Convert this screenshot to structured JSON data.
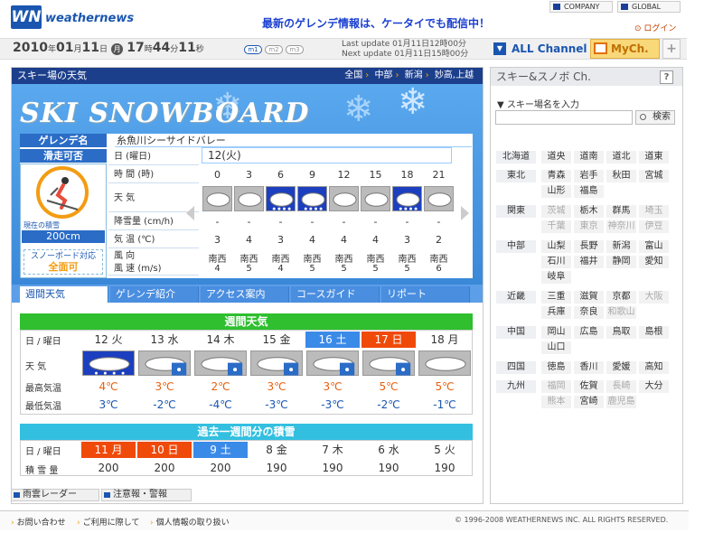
{
  "header": {
    "logo_mark": "WN",
    "logo_text": "weathernews",
    "promo": "最新のゲレンデ情報は、ケータイでも配信中！",
    "company": "COMPANY",
    "global": "GLOBAL",
    "login": "ログイン"
  },
  "datebar": {
    "year": "2010",
    "y": "年",
    "month": "01",
    "m": "月",
    "day": "11",
    "d": "日",
    "wd": "月",
    "hour": "17",
    "h": "時",
    "min": "44",
    "mn": "分",
    "sec": "11",
    "s": "秒",
    "modes": [
      "m1",
      "m2",
      "m3"
    ],
    "last_update": "Last update 01月11日12時00分",
    "next_update": "Next update 01月11日15時00分",
    "all_channel": "ALL Channel",
    "mych": "MyCh.",
    "plus": "+"
  },
  "main": {
    "title": "スキー場の天気",
    "crumbs": [
      "全国",
      "中部",
      "新潟",
      "妙高,上越"
    ],
    "banner": "SKI SNOWBOARD",
    "gelande_label": "ゲレンデ名",
    "gelande_name": "糸魚川シーサイドバレー",
    "status_label": "滑走可否",
    "snow_depth_label": "現在の積雪",
    "snow_depth": "200cm",
    "snowboard_label": "スノーボード対応",
    "snowboard_value": "全面可",
    "row_labels": [
      "日 (曜日)",
      "時 間 (時)",
      "天 気",
      "降雪量 (cm/h)",
      "気 温 (℃)",
      "風 向",
      "風 速 (m/s)"
    ],
    "day_header": "12(火)",
    "hours": [
      "0",
      "3",
      "6",
      "9",
      "12",
      "15",
      "18",
      "21"
    ],
    "hourly_weather": [
      "cloudy",
      "cloudy",
      "snow",
      "snow",
      "cloudy",
      "cloudy",
      "snow",
      "cloudy"
    ],
    "snowfall": [
      "-",
      "-",
      "-",
      "-",
      "-",
      "-",
      "-",
      "-"
    ],
    "temps": [
      "3",
      "4",
      "3",
      "4",
      "4",
      "4",
      "3",
      "2"
    ],
    "wind_dir": [
      "南西",
      "南西",
      "南西",
      "南西",
      "南西",
      "南西",
      "南西",
      "南西"
    ],
    "wind_speed": [
      "4",
      "5",
      "4",
      "5",
      "5",
      "5",
      "5",
      "6"
    ],
    "tabs": [
      "週間天気",
      "ゲレンデ紹介",
      "アクセス案内",
      "コースガイド",
      "リポート"
    ]
  },
  "weekly": {
    "title": "週間天気",
    "row_day_label": "日 / 曜日",
    "row_weather_label": "天 気",
    "row_high_label": "最高気温",
    "row_low_label": "最低気温",
    "days": [
      {
        "label": "12 火",
        "style": "normal",
        "icon": "snow-cloud",
        "high": "4℃",
        "low": "3℃"
      },
      {
        "label": "13 水",
        "style": "normal",
        "icon": "cloud-snow",
        "high": "3℃",
        "low": "-2℃"
      },
      {
        "label": "14 木",
        "style": "normal",
        "icon": "cloud-snow",
        "high": "2℃",
        "low": "-4℃"
      },
      {
        "label": "15 金",
        "style": "normal",
        "icon": "cloud-snow",
        "high": "3℃",
        "low": "-3℃"
      },
      {
        "label": "16 土",
        "style": "sat",
        "icon": "cloud-snow",
        "high": "3℃",
        "low": "-3℃"
      },
      {
        "label": "17 日",
        "style": "sun",
        "icon": "cloud-snow",
        "high": "5℃",
        "low": "-2℃"
      },
      {
        "label": "18 月",
        "style": "normal",
        "icon": "cloudy",
        "high": "5℃",
        "low": "-1℃"
      }
    ]
  },
  "history": {
    "title": "過去一週間分の積雪",
    "row_day_label": "日 / 曜日",
    "row_depth_label": "積 雪 量",
    "days": [
      {
        "label": "11 月",
        "style": "sun",
        "depth": "200"
      },
      {
        "label": "10 日",
        "style": "sun",
        "depth": "200"
      },
      {
        "label": "9 土",
        "style": "sat",
        "depth": "200"
      },
      {
        "label": "8 金",
        "style": "normal",
        "depth": "190"
      },
      {
        "label": "7 木",
        "style": "normal",
        "depth": "190"
      },
      {
        "label": "6 水",
        "style": "normal",
        "depth": "190"
      },
      {
        "label": "5 火",
        "style": "normal",
        "depth": "190"
      }
    ]
  },
  "bottom_links": [
    "雨雲レーダー",
    "注意報・警報"
  ],
  "footer": {
    "links": [
      "お問い合わせ",
      "ご利用に際して",
      "個人情報の取り扱い"
    ],
    "copyright": "© 1996-2008 WEATHERNEWS INC. ALL RIGHTS RESERVED."
  },
  "sidebar": {
    "title": "スキー&スノボ Ch.",
    "help": "?",
    "search_label": "スキー場名を入力",
    "search_button": "検索",
    "search_placeholder": "",
    "regions": [
      {
        "name": "北海道",
        "prefs": [
          {
            "n": "道央",
            "on": true
          },
          {
            "n": "道南",
            "on": true
          },
          {
            "n": "道北",
            "on": true
          },
          {
            "n": "道東",
            "on": true
          }
        ]
      },
      {
        "name": "東北",
        "prefs": [
          {
            "n": "青森",
            "on": true
          },
          {
            "n": "岩手",
            "on": true
          },
          {
            "n": "秋田",
            "on": true
          },
          {
            "n": "宮城",
            "on": true
          },
          {
            "n": "山形",
            "on": true
          },
          {
            "n": "福島",
            "on": true
          }
        ]
      },
      {
        "name": "関東",
        "prefs": [
          {
            "n": "茨城",
            "on": false
          },
          {
            "n": "栃木",
            "on": true
          },
          {
            "n": "群馬",
            "on": true
          },
          {
            "n": "埼玉",
            "on": false
          },
          {
            "n": "千葉",
            "on": false
          },
          {
            "n": "東京",
            "on": false
          },
          {
            "n": "神奈川",
            "on": false
          },
          {
            "n": "伊豆",
            "on": false
          }
        ]
      },
      {
        "name": "中部",
        "prefs": [
          {
            "n": "山梨",
            "on": true
          },
          {
            "n": "長野",
            "on": true
          },
          {
            "n": "新潟",
            "on": true
          },
          {
            "n": "富山",
            "on": true
          },
          {
            "n": "石川",
            "on": true
          },
          {
            "n": "福井",
            "on": true
          },
          {
            "n": "静岡",
            "on": true
          },
          {
            "n": "愛知",
            "on": true
          },
          {
            "n": "岐阜",
            "on": true
          }
        ]
      },
      {
        "name": "近畿",
        "prefs": [
          {
            "n": "三重",
            "on": true
          },
          {
            "n": "滋賀",
            "on": true
          },
          {
            "n": "京都",
            "on": true
          },
          {
            "n": "大阪",
            "on": false
          },
          {
            "n": "兵庫",
            "on": true
          },
          {
            "n": "奈良",
            "on": true
          },
          {
            "n": "和歌山",
            "on": false
          }
        ]
      },
      {
        "name": "中国",
        "prefs": [
          {
            "n": "岡山",
            "on": true
          },
          {
            "n": "広島",
            "on": true
          },
          {
            "n": "鳥取",
            "on": true
          },
          {
            "n": "島根",
            "on": true
          },
          {
            "n": "山口",
            "on": true
          }
        ]
      },
      {
        "name": "四国",
        "prefs": [
          {
            "n": "徳島",
            "on": true
          },
          {
            "n": "香川",
            "on": true
          },
          {
            "n": "愛媛",
            "on": true
          },
          {
            "n": "高知",
            "on": true
          }
        ]
      },
      {
        "name": "九州",
        "prefs": [
          {
            "n": "福岡",
            "on": false
          },
          {
            "n": "佐賀",
            "on": true
          },
          {
            "n": "長崎",
            "on": false
          },
          {
            "n": "大分",
            "on": true
          },
          {
            "n": "熊本",
            "on": false
          },
          {
            "n": "宮崎",
            "on": true
          },
          {
            "n": "鹿児島",
            "on": false
          }
        ]
      }
    ]
  },
  "colors": {
    "brand_blue": "#1a56b0",
    "header_navy": "#1c3f8c",
    "weekly_green": "#2fbf2f",
    "history_cyan": "#33bfe0",
    "saturday": "#3a8ae8",
    "sunday": "#f04a0a"
  }
}
